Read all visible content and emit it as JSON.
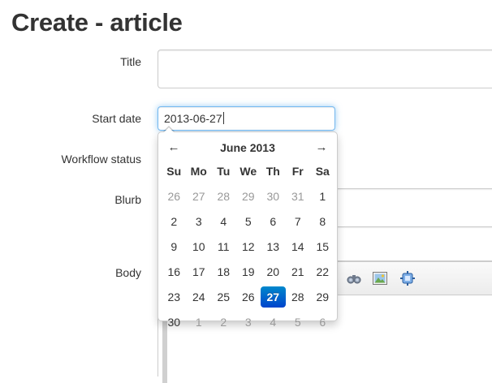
{
  "page": {
    "title": "Create - article"
  },
  "form": {
    "title_label": "Title",
    "title_value": "",
    "start_date_label": "Start date",
    "start_date_value": "2013-06-27",
    "workflow_label": "Workflow status",
    "blurb_label": "Blurb",
    "body_label": "Body"
  },
  "datepicker": {
    "month_label": "June 2013",
    "prev_icon": "arrow-left-icon",
    "next_icon": "arrow-right-icon",
    "weekdays": [
      "Su",
      "Mo",
      "Tu",
      "We",
      "Th",
      "Fr",
      "Sa"
    ],
    "weeks": [
      [
        "26",
        "27",
        "28",
        "29",
        "30",
        "31",
        "1"
      ],
      [
        "2",
        "3",
        "4",
        "5",
        "6",
        "7",
        "8"
      ],
      [
        "9",
        "10",
        "11",
        "12",
        "13",
        "14",
        "15"
      ],
      [
        "16",
        "17",
        "18",
        "19",
        "20",
        "21",
        "22"
      ],
      [
        "23",
        "24",
        "25",
        "26",
        "27",
        "28",
        "29"
      ],
      [
        "30",
        "1",
        "2",
        "3",
        "4",
        "5",
        "6"
      ]
    ],
    "outside_month": [
      [
        true,
        true,
        true,
        true,
        true,
        true,
        false
      ],
      [
        false,
        false,
        false,
        false,
        false,
        false,
        false
      ],
      [
        false,
        false,
        false,
        false,
        false,
        false,
        false
      ],
      [
        false,
        false,
        false,
        false,
        false,
        false,
        false
      ],
      [
        false,
        false,
        false,
        false,
        false,
        false,
        false
      ],
      [
        false,
        true,
        true,
        true,
        true,
        true,
        true
      ]
    ],
    "selected_day": "27",
    "accent_color": "#0066cc"
  },
  "editor": {
    "toolbar_icons": [
      "binoculars-icon",
      "image-icon",
      "widget-icon"
    ]
  }
}
